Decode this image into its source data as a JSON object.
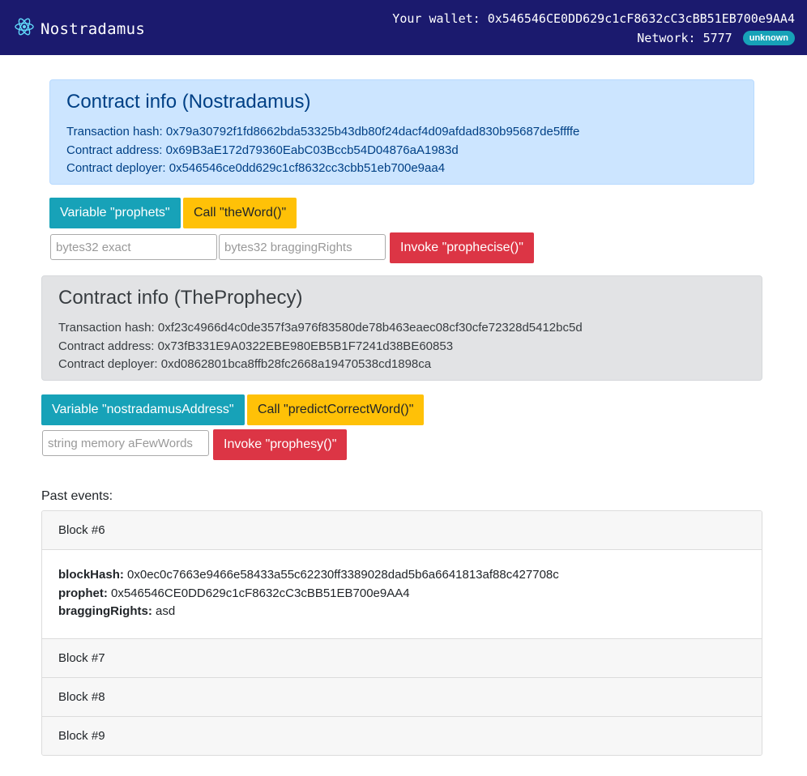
{
  "app": {
    "name": "Nostradamus",
    "wallet_label": "Your wallet:",
    "wallet_address": "0x546546CE0DD629c1cF8632cC3cBB51EB700e9AA4",
    "network_label": "Network:",
    "network_id": "5777",
    "network_badge": "unknown"
  },
  "nostradamus": {
    "title": "Contract info (Nostradamus)",
    "tx_hash_label": "Transaction hash:",
    "tx_hash": "0x79a30792f1fd8662bda53325b43db80f24dacf4d09afdad830b95687de5ffffe",
    "address_label": "Contract address:",
    "address": "0x69B3aE172d79360EabC03Bccb54D04876aA1983d",
    "deployer_label": "Contract deployer:",
    "deployer": "0x546546ce0dd629c1cf8632cc3cbb51eb700e9aa4",
    "btn_variable": "Variable \"prophets\"",
    "btn_call": "Call \"theWord()\"",
    "input_exact_placeholder": "bytes32 exact",
    "input_bragging_placeholder": "bytes32 braggingRights",
    "btn_invoke": "Invoke \"prophecise()\""
  },
  "prophecy": {
    "title": "Contract info (TheProphecy)",
    "tx_hash_label": "Transaction hash:",
    "tx_hash": "0xf23c4966d4c0de357f3a976f83580de78b463eaec08cf30cfe72328d5412bc5d",
    "address_label": "Contract address:",
    "address": "0x73fB331E9A0322EBE980EB5B1F7241d38BE60853",
    "deployer_label": "Contract deployer:",
    "deployer": "0xd0862801bca8ffb28fc2668a19470538cd1898ca",
    "btn_variable": "Variable \"nostradamusAddress\"",
    "btn_call": "Call \"predictCorrectWord()\"",
    "input_words_placeholder": "string memory aFewWords",
    "btn_invoke": "Invoke \"prophesy()\""
  },
  "events": {
    "label": "Past events:",
    "blocks": [
      {
        "title": "Block #6",
        "fields": [
          {
            "key": "blockHash:",
            "value": "0x0ec0c7663e9466e58433a55c62230ff3389028dad5b6a6641813af88c427708c"
          },
          {
            "key": "prophet:",
            "value": "0x546546CE0DD629c1cF8632cC3cBB51EB700e9AA4"
          },
          {
            "key": "braggingRights:",
            "value": "asd"
          }
        ]
      },
      {
        "title": "Block #7"
      },
      {
        "title": "Block #8"
      },
      {
        "title": "Block #9"
      }
    ]
  }
}
